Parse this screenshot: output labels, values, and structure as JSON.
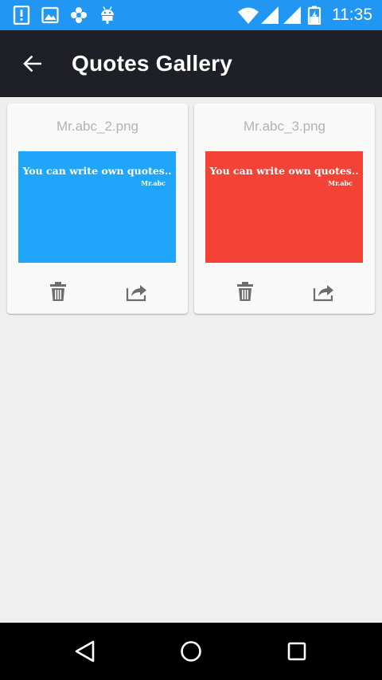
{
  "status_bar": {
    "time": "11:35",
    "background": "#2196f3",
    "left_icons": [
      "notification-alert-icon",
      "image-icon",
      "flower-icon",
      "android-icon"
    ],
    "right_icons": [
      "wifi-icon",
      "signal-icon",
      "signal-icon",
      "battery-charging-icon"
    ]
  },
  "app_bar": {
    "title": "Quotes Gallery",
    "background": "#1e1f27",
    "back_icon": "arrow-back-icon"
  },
  "gallery": {
    "items": [
      {
        "file_name": "Mr.abc_2.png",
        "quote": "You can write own quotes..",
        "author": "Mr.abc",
        "color": "#1fa6fb"
      },
      {
        "file_name": "Mr.abc_3.png",
        "quote": "You can write own quotes..",
        "author": "Mr.abc",
        "color": "#f44336"
      }
    ],
    "actions": [
      "delete-icon",
      "share-icon"
    ]
  },
  "nav_bar": {
    "buttons": [
      "back-triangle-icon",
      "home-circle-icon",
      "recents-square-icon"
    ]
  }
}
